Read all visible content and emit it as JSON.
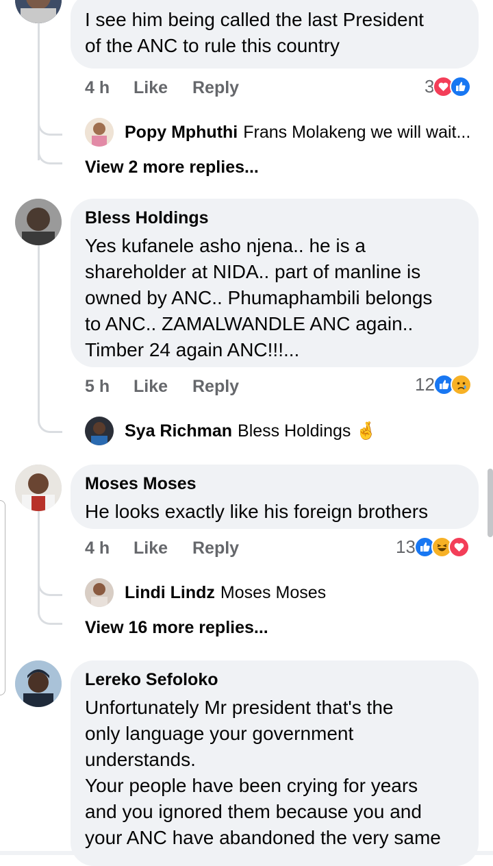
{
  "colors": {
    "bubble_bg": "#f0f2f5",
    "meta_text": "#65676b",
    "like_blue": "#1877f2",
    "love_red": "#f33e58",
    "haha_yellow": "#f7b125"
  },
  "comments": [
    {
      "author": "",
      "text": "I see him being called the last President\nof the ANC to rule this country",
      "time": "4 h",
      "like": "Like",
      "reply": "Reply",
      "reaction_count": "3",
      "reactions": [
        "love",
        "like"
      ],
      "reply_preview": {
        "name": "Popy Mphuthi",
        "text": "Frans Molakeng we will wait..."
      },
      "more_replies": "View 2 more replies..."
    },
    {
      "author": "Bless Holdings",
      "text": "Yes kufanele asho njena.. he is a\nshareholder at NIDA.. part of manline is\nowned by ANC.. Phumaphambili belongs\nto ANC.. ZAMALWANDLE ANC again..\nTimber 24 again ANC!!!...",
      "time": "5 h",
      "like": "Like",
      "reply": "Reply",
      "reaction_count": "12",
      "reactions": [
        "like",
        "sad"
      ],
      "reply_preview": {
        "name": "Sya Richman",
        "text": "Bless Holdings 🤞"
      }
    },
    {
      "author": "Moses Moses",
      "text": "He looks exactly like his foreign brothers",
      "time": "4 h",
      "like": "Like",
      "reply": "Reply",
      "reaction_count": "13",
      "reactions": [
        "like",
        "haha",
        "love"
      ],
      "reply_preview": {
        "name": "Lindi Lindz",
        "text": "Moses Moses"
      },
      "more_replies": "View 16 more replies..."
    },
    {
      "author": "Lereko Sefoloko",
      "text": "Unfortunately Mr president that's the\nonly language your government\nunderstands.\nYour people have been crying for years\nand you ignored them because you and\nyour ANC have abandoned the very same"
    }
  ]
}
